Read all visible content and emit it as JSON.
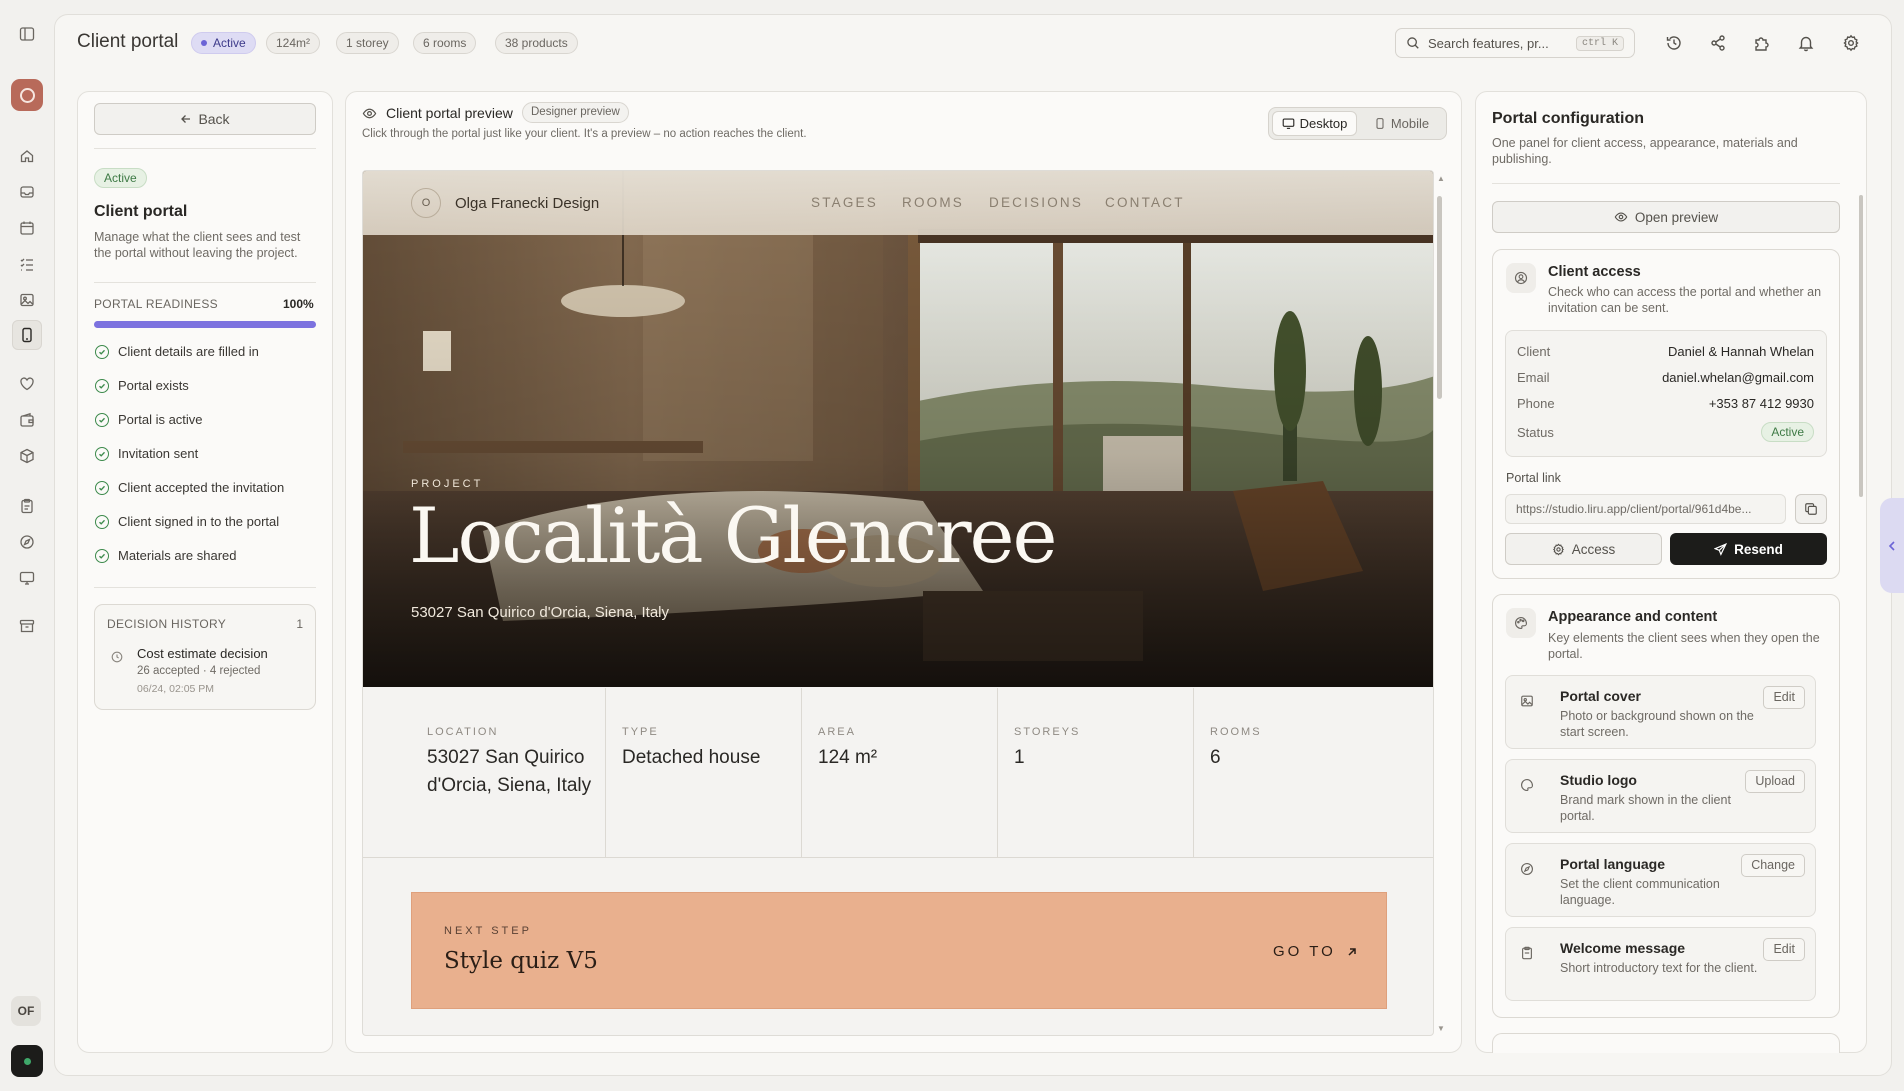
{
  "topbar": {
    "title": "Client portal",
    "status": "Active",
    "chips": [
      "124m²",
      "1 storey",
      "6 rooms",
      "38 products"
    ],
    "search_placeholder": "Search features, pr...",
    "search_shortcut": "ctrl K",
    "icons": [
      "history-icon",
      "share-icon",
      "puzzle-icon",
      "bell-icon",
      "settings-icon"
    ]
  },
  "rail": {
    "avatar_initials": "OF",
    "icons": [
      "sidebar-toggle-icon",
      "home-icon",
      "inbox-icon",
      "calendar-icon",
      "checklist-icon",
      "image-icon",
      "phone-icon",
      "heart-icon",
      "wallet-icon",
      "box-icon",
      "clipboard-icon",
      "compass-icon",
      "monitor-icon",
      "archive-icon"
    ]
  },
  "left": {
    "back_label": "Back",
    "status": "Active",
    "title": "Client portal",
    "description": "Manage what the client sees and test the portal without leaving the project.",
    "readiness_label": "PORTAL READINESS",
    "readiness_value": "100%",
    "readiness_fraction": 1.0,
    "checklist": [
      "Client details are filled in",
      "Portal exists",
      "Portal is active",
      "Invitation sent",
      "Client accepted the invitation",
      "Client signed in to the portal",
      "Materials are shared"
    ],
    "decision_history": {
      "title": "DECISION HISTORY",
      "count": "1",
      "item_title": "Cost estimate decision",
      "item_meta": "26 accepted · 4 rejected",
      "item_time": "06/24, 02:05 PM"
    }
  },
  "preview": {
    "title": "Client portal preview",
    "tag": "Designer preview",
    "subtitle": "Click through the portal just like your client. It's a preview – no action reaches the client.",
    "desktop_label": "Desktop",
    "mobile_label": "Mobile",
    "site": {
      "logo_letter": "O",
      "studio": "Olga Franecki Design",
      "nav": [
        "STAGES",
        "ROOMS",
        "DECISIONS",
        "CONTACT"
      ],
      "kicker": "PROJECT",
      "project_title": "Località Glencree",
      "address": "53027 San Quirico d'Orcia, Siena, Italy",
      "stats": [
        {
          "label": "LOCATION",
          "value": "53027 San Quirico d'Orcia, Siena, Italy"
        },
        {
          "label": "TYPE",
          "value": "Detached house"
        },
        {
          "label": "AREA",
          "value": "124 m²"
        },
        {
          "label": "STOREYS",
          "value": "1"
        },
        {
          "label": "ROOMS",
          "value": "6"
        }
      ],
      "next_step_label": "NEXT STEP",
      "next_step_title": "Style quiz V5",
      "go_to": "GO TO"
    }
  },
  "config": {
    "title": "Portal configuration",
    "description": "One panel for client access, appearance, materials and publishing.",
    "open_preview": "Open preview",
    "access": {
      "title": "Client access",
      "description": "Check who can access the portal and whether an invitation can be sent.",
      "rows": [
        {
          "k": "Client",
          "v": "Daniel & Hannah Whelan"
        },
        {
          "k": "Email",
          "v": "daniel.whelan@gmail.com"
        },
        {
          "k": "Phone",
          "v": "+353 87 412 9930"
        }
      ],
      "status_label": "Status",
      "status_value": "Active",
      "portal_link_label": "Portal link",
      "portal_link": "https://studio.liru.app/client/portal/961d4be...",
      "access_button": "Access",
      "resend_button": "Resend"
    },
    "appearance": {
      "title": "Appearance and content",
      "description": "Key elements the client sees when they open the portal.",
      "items": [
        {
          "title": "Portal cover",
          "desc": "Photo or background shown on the start screen.",
          "button": "Edit",
          "icon": "image-icon"
        },
        {
          "title": "Studio logo",
          "desc": "Brand mark shown in the client portal.",
          "button": "Upload",
          "icon": "palette-icon"
        },
        {
          "title": "Portal language",
          "desc": "Set the client communication language.",
          "button": "Change",
          "icon": "globe-icon"
        },
        {
          "title": "Welcome message",
          "desc": "Short introductory text for the client.",
          "button": "Edit",
          "icon": "clipboard-icon"
        }
      ]
    }
  },
  "colors": {
    "accent": "#7c72df",
    "success": "#3e7a45",
    "cta": "#e9b08e",
    "dark_button": "#1c1c1a"
  }
}
